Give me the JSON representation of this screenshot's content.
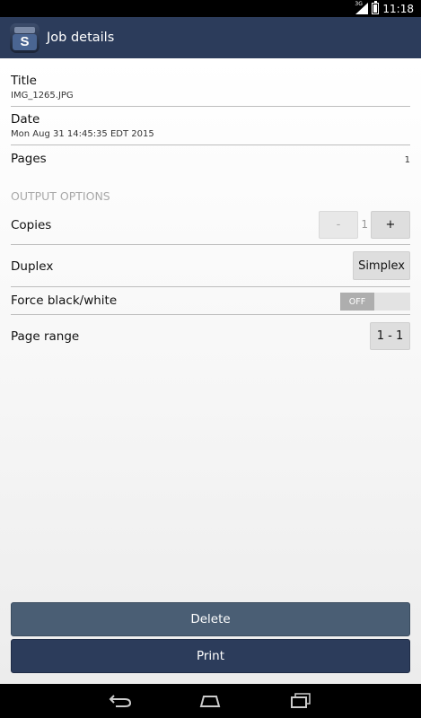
{
  "status_bar": {
    "network": "3G",
    "time": "11:18"
  },
  "action_bar": {
    "app_icon_letter": "S",
    "title": "Job details",
    "color": "#2c3c5b"
  },
  "details": {
    "title_label": "Title",
    "title_value": "IMG_1265.JPG",
    "date_label": "Date",
    "date_value": "Mon Aug 31 14:45:35 EDT 2015",
    "pages_label": "Pages",
    "pages_value": "1"
  },
  "output_options": {
    "header": "OUTPUT OPTIONS",
    "copies_label": "Copies",
    "copies_minus": "-",
    "copies_value": "1",
    "copies_plus": "+",
    "duplex_label": "Duplex",
    "duplex_value": "Simplex",
    "force_bw_label": "Force black/white",
    "force_bw_state": "OFF",
    "page_range_label": "Page range",
    "page_range_value": "1 - 1"
  },
  "buttons": {
    "delete_label": "Delete",
    "print_label": "Print",
    "delete_color": "#4a5e74",
    "print_color": "#2c3c5b"
  },
  "nav_bar": {
    "icons": [
      "back-icon",
      "home-icon",
      "recent-apps-icon"
    ]
  }
}
